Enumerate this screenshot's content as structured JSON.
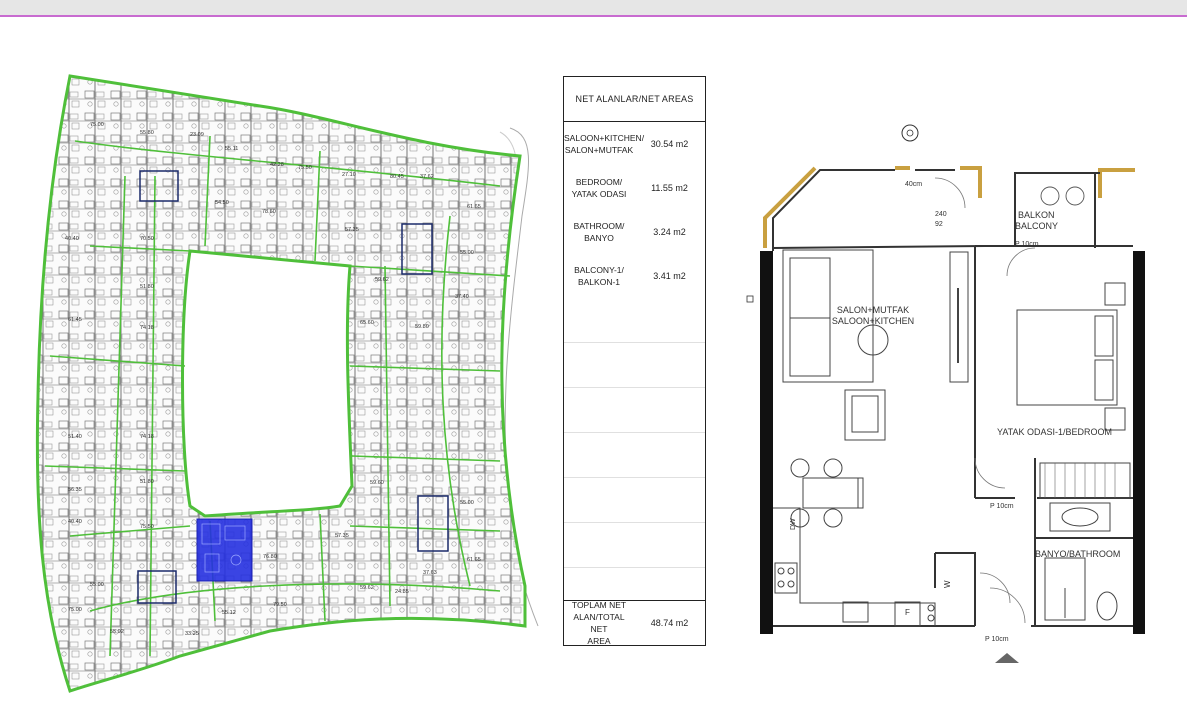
{
  "net_areas": {
    "header": "NET ALANLAR/NET AREAS",
    "rows": [
      {
        "label_1": "SALOON+KITCHEN/",
        "label_2": "SALON+MUTFAK",
        "value": "30.54 m2"
      },
      {
        "label_1": "BEDROOM/",
        "label_2": "YATAK ODASI",
        "value": "11.55 m2"
      },
      {
        "label_1": "BATHROOM/",
        "label_2": "BANYO",
        "value": "3.24 m2"
      },
      {
        "label_1": "BALCONY-1/",
        "label_2": "BALKON-1",
        "value": "3.41 m2"
      }
    ],
    "total": {
      "label_1": "TOPLAM NET",
      "label_2": "ALAN/TOTAL NET",
      "label_3": "AREA",
      "value": "48.74 m2"
    }
  },
  "unit_plan": {
    "salon_1": "SALON+MUTFAK",
    "salon_2": "SALOON+KITCHEN",
    "balkon_1": "BALKON",
    "balkon_2": "BALCONY",
    "bedroom": "YATAK ODASI-1/BEDROOM",
    "bathroom": "BANYO/BATHROOM",
    "parapet_1": "P 10cm",
    "parapet_2": "P 10cm",
    "parapet_3": "P 10cm",
    "door_1": "40cm",
    "dim_1": "240",
    "dim_2": "92",
    "fridge": "F",
    "washer": "W",
    "dishwasher": "DW"
  },
  "site_plan": {
    "highlight_color": "#2530e0",
    "wall_color": "#4fbf3a",
    "areas": [
      "75.00",
      "55.80",
      "23.09",
      "55.11",
      "42.28",
      "75.50",
      "27.10",
      "80.45",
      "37.62",
      "61.65",
      "40.40",
      "70.50",
      "54.50",
      "78.60",
      "57.35",
      "55.00",
      "51.80",
      "59.62",
      "37.40",
      "61.45",
      "74.18",
      "65.60",
      "59.80",
      "51.40",
      "74.18",
      "56.35",
      "51.80",
      "59.60",
      "40.40",
      "75.50",
      "76.80",
      "57.35",
      "55.00",
      "55.00",
      "59.62",
      "24.85",
      "37.63",
      "61.65",
      "75.00",
      "55.92",
      "33.25",
      "55.12",
      "79.50"
    ]
  },
  "colors": {
    "outline": "#222222",
    "balcony_wall": "#c9a040",
    "ext_wall": "#111111"
  }
}
